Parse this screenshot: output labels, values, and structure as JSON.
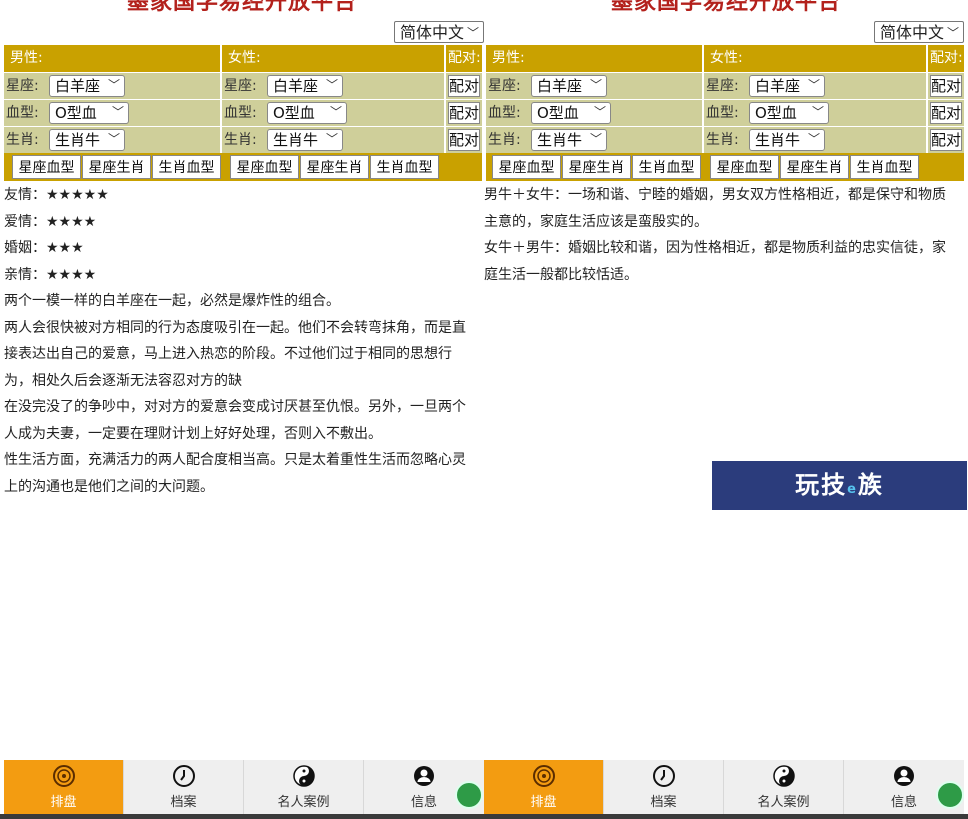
{
  "title": "墨家国学易经开放平台",
  "language": "简体中文",
  "form": {
    "male_header": "男性:",
    "female_header": "女性:",
    "pair_header": "配对:",
    "row_labels": [
      "星座:",
      "血型:",
      "生肖:"
    ],
    "pair_button": "配对",
    "mode_buttons": [
      "星座血型",
      "星座生肖",
      "生肖血型"
    ]
  },
  "left": {
    "male": {
      "zodiac": "白羊座",
      "blood": "O型血",
      "animal": "生肖牛"
    },
    "female": {
      "zodiac": "白羊座",
      "blood": "O型血",
      "animal": "生肖牛"
    },
    "ratings": [
      {
        "label": "友情：",
        "stars": "★★★★★"
      },
      {
        "label": "爱情：",
        "stars": "★★★★"
      },
      {
        "label": "婚姻：",
        "stars": "★★★"
      },
      {
        "label": "亲情：",
        "stars": "★★★★"
      }
    ],
    "paragraphs": [
      "两个一模一样的白羊座在一起，必然是爆炸性的组合。",
      "两人会很快被对方相同的行为态度吸引在一起。他们不会转弯抹角，而是直接表达出自己的爱意，马上进入热恋的阶段。不过他们过于相同的思想行为，相处久后会逐渐无法容忍对方的缺",
      "在没完没了的争吵中，对对方的爱意会变成讨厌甚至仇恨。另外，一旦两个人成为夫妻，一定要在理财计划上好好处理，否则入不敷出。",
      "性生活方面，充满活力的两人配合度相当高。只是太着重性生活而忽略心灵上的沟通也是他们之间的大问题。"
    ]
  },
  "right": {
    "male": {
      "zodiac": "白羊座",
      "blood": "O型血",
      "animal": "生肖牛"
    },
    "female": {
      "zodiac": "白羊座",
      "blood": "O型血",
      "animal": "生肖牛"
    },
    "paragraphs": [
      "男牛＋女牛：一场和谐、宁睦的婚姻，男女双方性格相近，都是保守和物质主意的，家庭生活应该是蛮殷实的。",
      "女牛＋男牛：婚姻比较和谐，因为性格相近，都是物质利益的忠实信徒，家庭生活一般都比较恬适。"
    ],
    "banner": "玩技",
    "banner_small": "e",
    "banner_tail": "族"
  },
  "tabs": [
    {
      "label": "排盘",
      "icon": "chart-disc-icon"
    },
    {
      "label": "档案",
      "icon": "clock-icon"
    },
    {
      "label": "名人案例",
      "icon": "yin-yang-icon"
    },
    {
      "label": "信息",
      "icon": "user-icon"
    }
  ],
  "colors": {
    "accent": "#c9a100",
    "cell": "#cfcf9a",
    "title": "#b3211c",
    "tab_active": "#f39c11"
  }
}
